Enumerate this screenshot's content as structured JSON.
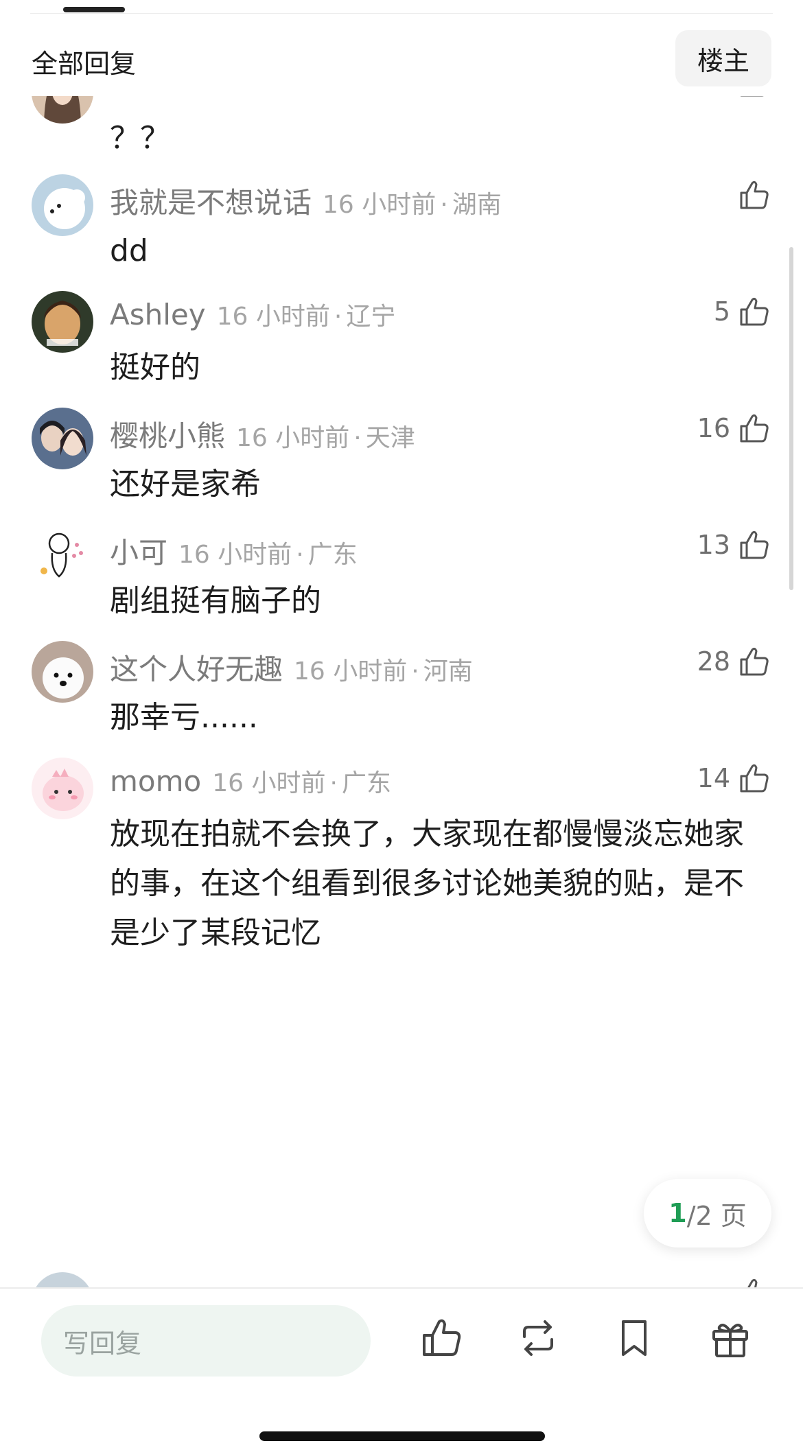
{
  "header": {
    "title": "全部回复",
    "op_button_label": "楼主"
  },
  "comments": [
    {
      "name": "",
      "time": "",
      "region": "",
      "text": "？？",
      "likes": "",
      "avatar_desc": "long-hair-woman-avatar"
    },
    {
      "name": "我就是不想说话",
      "time": "16 小时前",
      "region": "湖南",
      "text": "dd",
      "likes": "",
      "avatar_desc": "white-fluffy-dog-avatar"
    },
    {
      "name": "Ashley",
      "time": "16 小时前",
      "region": "辽宁",
      "text": "挺好的",
      "likes": "5",
      "avatar_desc": "painting-portrait-avatar"
    },
    {
      "name": "樱桃小熊",
      "time": "16 小时前",
      "region": "天津",
      "text": "还好是家希",
      "likes": "16",
      "avatar_desc": "couple-photo-avatar"
    },
    {
      "name": "小可",
      "time": "16 小时前",
      "region": "广东",
      "text": "剧组挺有脑子的",
      "likes": "13",
      "avatar_desc": "doodle-character-avatar"
    },
    {
      "name": "这个人好无趣",
      "time": "16 小时前",
      "region": "河南",
      "text": "那幸亏......",
      "likes": "28",
      "avatar_desc": "white-puppy-avatar"
    },
    {
      "name": "momo",
      "time": "16 小时前",
      "region": "广东",
      "text": "放现在拍就不会换了，大家现在都慢慢淡忘她家的事，在这个组看到很多讨论她美貌的贴，是不是少了某段记忆",
      "likes": "14",
      "avatar_desc": "pink-dinosaur-avatar"
    }
  ],
  "pagination": {
    "current": "1",
    "rest": "/2 页"
  },
  "bottom_bar": {
    "reply_placeholder": "写回复",
    "icons": [
      "thumbs-up-icon",
      "repost-icon",
      "bookmark-icon",
      "gift-icon"
    ]
  },
  "colors": {
    "accent": "#1f9d55",
    "meta_text": "#a5a5a5",
    "input_bg": "#eef5f1"
  }
}
